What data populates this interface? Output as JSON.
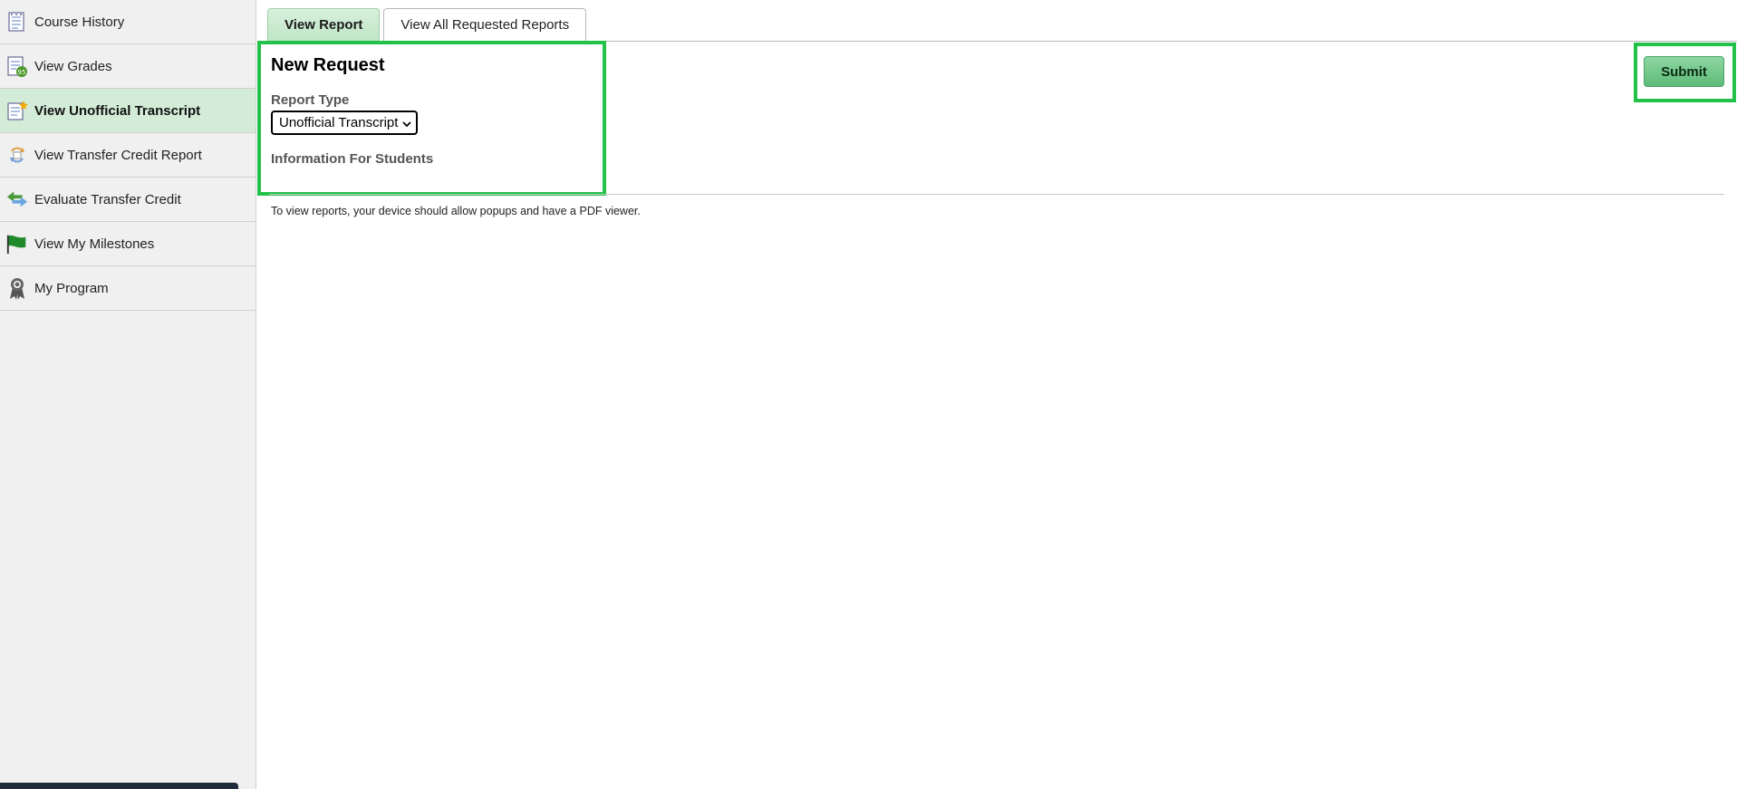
{
  "sidebar": {
    "items": [
      {
        "label": "Course History",
        "icon": "course-history-icon",
        "active": false
      },
      {
        "label": "View Grades",
        "icon": "grades-icon",
        "active": false
      },
      {
        "label": "View Unofficial Transcript",
        "icon": "transcript-icon",
        "active": true
      },
      {
        "label": "View Transfer Credit Report",
        "icon": "transfer-report-icon",
        "active": false
      },
      {
        "label": "Evaluate Transfer Credit",
        "icon": "evaluate-transfer-icon",
        "active": false
      },
      {
        "label": "View My Milestones",
        "icon": "flag-icon",
        "active": false
      },
      {
        "label": "My Program",
        "icon": "award-ribbon-icon",
        "active": false
      }
    ]
  },
  "tabs": [
    {
      "label": "View Report",
      "active": true
    },
    {
      "label": "View All Requested Reports",
      "active": false
    }
  ],
  "request": {
    "title": "New Request",
    "report_type_label": "Report Type",
    "report_type_value": "Unofficial Transcript",
    "info_heading": "Information For Students",
    "note": "To view reports, your device should allow popups and have a PDF viewer."
  },
  "actions": {
    "submit_label": "Submit"
  },
  "colors": {
    "accent_green": "#22c24a",
    "active_bg": "#d3ecd7",
    "sidebar_bg": "#f0f0f0"
  }
}
